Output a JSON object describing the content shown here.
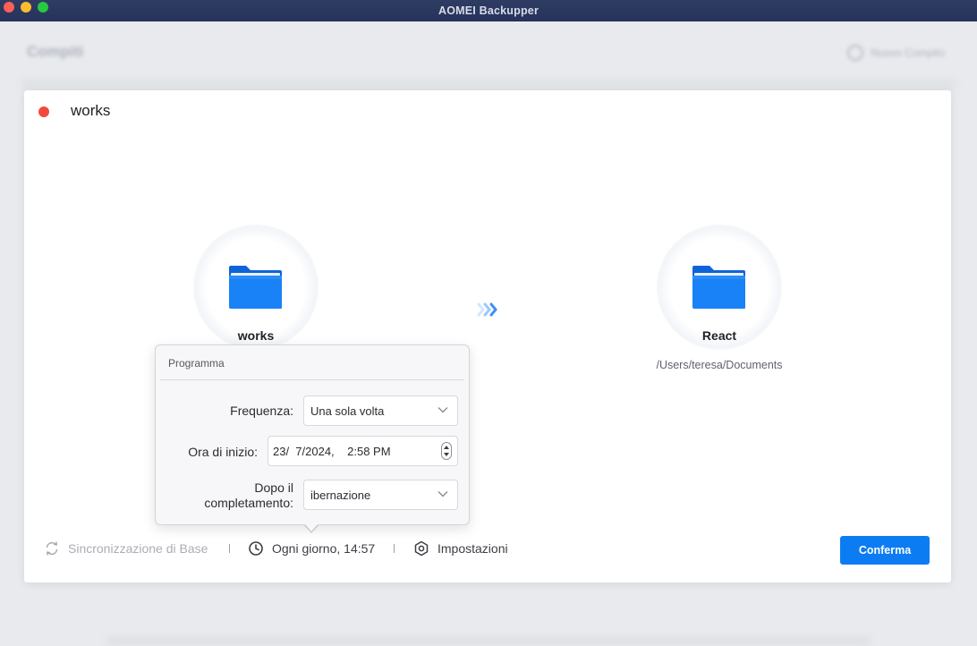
{
  "window": {
    "title": "AOMEI Backupper"
  },
  "background": {
    "page_title": "Compiti",
    "new_task_label": "Nuovo Compito"
  },
  "task": {
    "name": "works",
    "status_color": "#f2483c"
  },
  "source": {
    "name": "works",
    "icon": "folder-icon"
  },
  "destination": {
    "name": "React",
    "path": "/Users/teresa/Documents",
    "icon": "folder-icon"
  },
  "schedule_popover": {
    "title": "Programma",
    "frequency_label": "Frequenza:",
    "frequency_value": "Una sola volta",
    "start_time_label": "Ora di inizio:",
    "start_time_value": "23/  7/2024,    2:58 PM",
    "after_completion_label_line1": "Dopo il",
    "after_completion_label_line2": "completamento:",
    "after_completion_value": "ibernazione"
  },
  "bottom_bar": {
    "sync_mode": "Sincronizzazione di Base",
    "schedule": "Ogni giorno, 14:57",
    "settings": "Impostazioni",
    "confirm_button": "Conferma"
  },
  "colors": {
    "accent": "#0c7cf2",
    "folder": "#1778f2"
  }
}
